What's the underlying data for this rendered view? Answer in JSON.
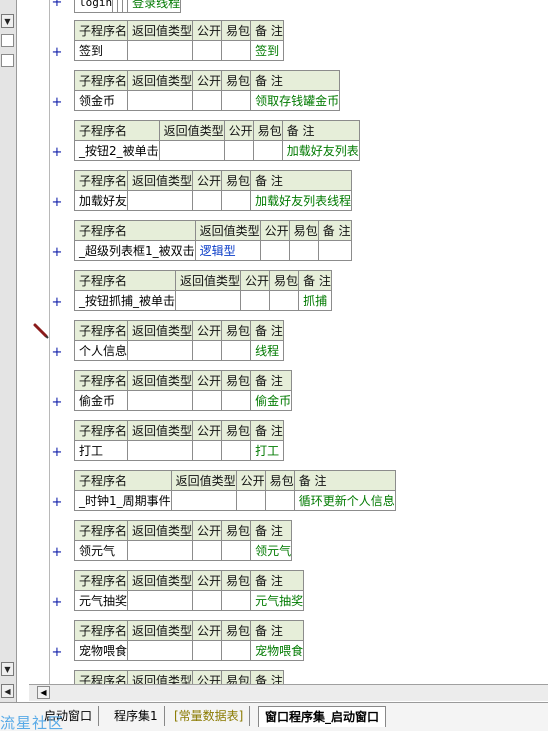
{
  "header_labels": {
    "name": "子程序名",
    "return_type": "返回值类型",
    "public": "公开",
    "easy_pack": "易包",
    "remark": "备 注"
  },
  "expand_symbol": "+",
  "partial_top": {
    "name": "login",
    "remark": "登录线程"
  },
  "subroutines": [
    {
      "name": "签到",
      "return_type": "",
      "remark": "签到"
    },
    {
      "name": "领金币",
      "return_type": "",
      "remark": "领取存钱罐金币"
    },
    {
      "name": "_按钮2_被单击",
      "return_type": "",
      "remark": "加载好友列表"
    },
    {
      "name": "加载好友",
      "return_type": "",
      "remark": "加载好友列表线程"
    },
    {
      "name": "_超级列表框1_被双击",
      "return_type": "逻辑型",
      "remark": ""
    },
    {
      "name": "_按钮抓捕_被单击",
      "return_type": "",
      "remark": "抓捕"
    },
    {
      "name": "个人信息",
      "return_type": "",
      "remark": "线程"
    },
    {
      "name": "偷金币",
      "return_type": "",
      "remark": "偷金币"
    },
    {
      "name": "打工",
      "return_type": "",
      "remark": "打工"
    },
    {
      "name": "_时钟1_周期事件",
      "return_type": "",
      "remark": "循环更新个人信息"
    },
    {
      "name": "领元气",
      "return_type": "",
      "remark": "领元气"
    },
    {
      "name": "元气抽奖",
      "return_type": "",
      "remark": "元气抽奖"
    },
    {
      "name": "宠物喂食",
      "return_type": "",
      "remark": "宠物喂食"
    }
  ],
  "tabs": [
    {
      "label": "启动窗口"
    },
    {
      "label": "程序集1"
    },
    {
      "label": "[常量数据表]"
    },
    {
      "label": "窗口程序集_启动窗口"
    }
  ],
  "watermark": "流星社区",
  "colors": {
    "header_bg": "#e6eed9",
    "remark_text": "#007a00",
    "return_type_text": "#0a3cc8",
    "expand_plus": "#0c1aa8"
  },
  "icons": {
    "edit_marker": "pencil-icon",
    "scroll_left": "arrow-left-icon",
    "scroll_up": "arrow-up-icon",
    "scroll_down": "arrow-down-icon"
  }
}
